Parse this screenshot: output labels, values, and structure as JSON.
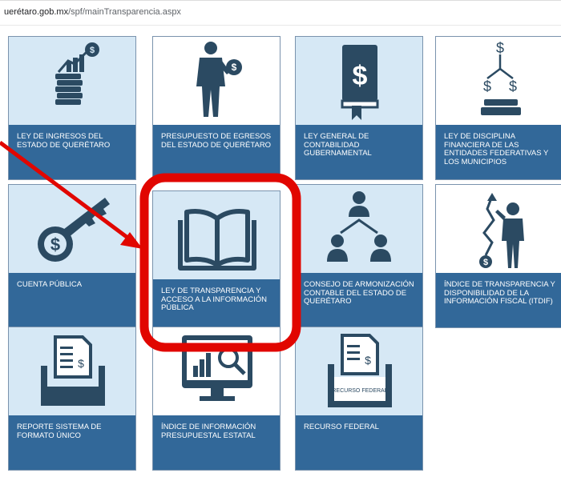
{
  "browser": {
    "url_host": "uerétaro.gob.mx",
    "url_path": "/spf/mainTransparencia.aspx"
  },
  "tiles": [
    {
      "label": "LEY DE INGRESOS DEL ESTADO DE QUERÉTARO",
      "icon": "coins-growth-icon"
    },
    {
      "label": "PRESUPUESTO DE EGRESOS DEL ESTADO DE QUERÉTARO",
      "icon": "businessman-money-icon"
    },
    {
      "label": "LEY GENERAL DE CONTABILIDAD GUBERNAMENTAL",
      "icon": "dollar-book-icon"
    },
    {
      "label": "LEY DE DISCIPLINA FINANCIERA DE LAS ENTIDADES FEDERATIVAS Y LOS MUNICIPIOS",
      "icon": "dollar-balance-icon"
    },
    {
      "label": "CUENTA PÚBLICA",
      "icon": "dollar-key-icon"
    },
    {
      "label": "LEY DE TRANSPARENCIA Y ACCESO A LA INFORMACIÓN PÚBLICA",
      "icon": "open-book-icon"
    },
    {
      "label": "CONSEJO DE ARMONIZACIÓN CONTABLE DEL ESTADO DE QUERÉTARO",
      "icon": "org-chart-icon"
    },
    {
      "label": "ÍNDICE DE TRANSPARENCIA Y DISPONIBILIDAD DE LA INFORMACIÓN FISCAL (ITDIF)",
      "icon": "businessman-chart-icon"
    },
    {
      "label": "REPORTE SISTEMA DE FORMATO ÚNICO",
      "icon": "document-tray-icon"
    },
    {
      "label": "ÍNDICE DE INFORMACIÓN PRESUPUESTAL ESTATAL",
      "icon": "monitor-chart-search-icon"
    },
    {
      "label": "RECURSO FEDERAL",
      "icon": "federal-resource-tray-icon",
      "icon_text": "RECURSO FEDERAL"
    }
  ],
  "annotation": {
    "highlight_color": "#e10600"
  }
}
